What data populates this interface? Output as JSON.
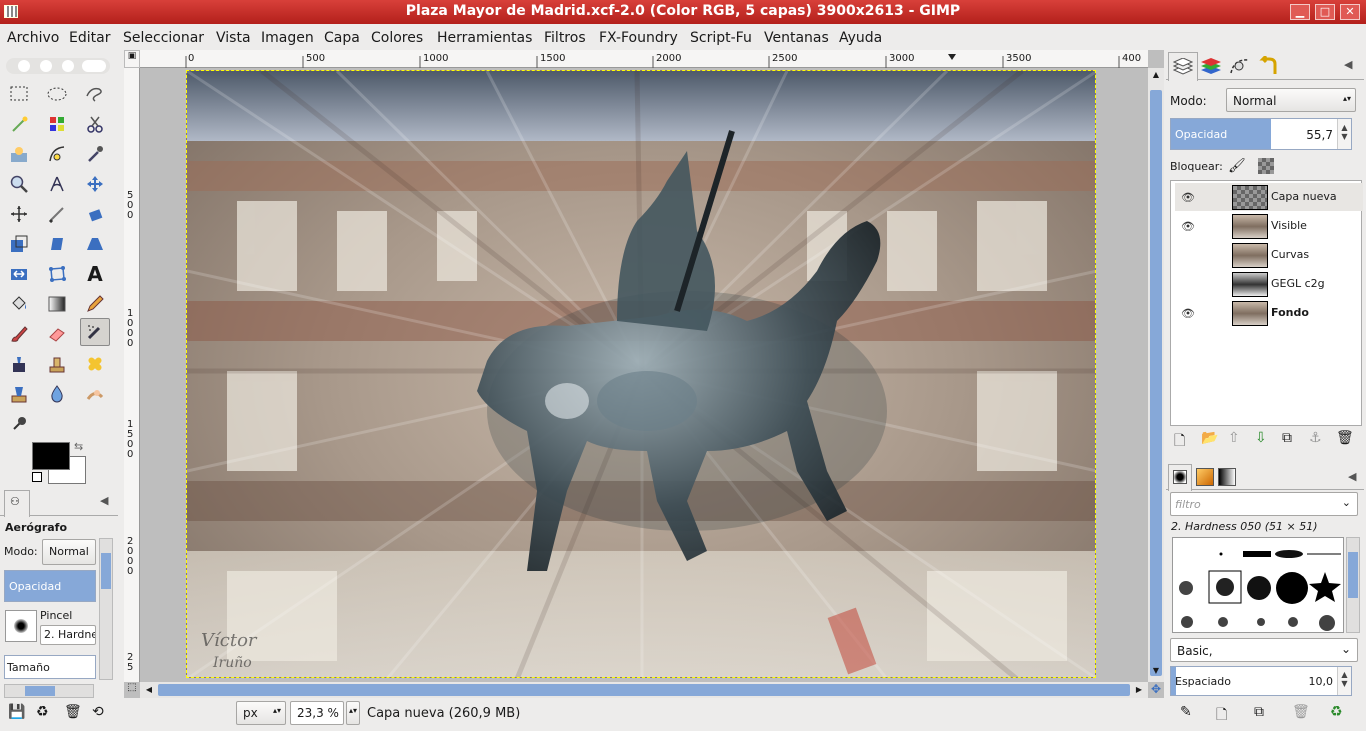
{
  "window": {
    "title": "Plaza Mayor de Madrid.xcf-2.0 (Color RGB, 5 capas) 3900x2613 - GIMP"
  },
  "menu": [
    "Archivo",
    "Editar",
    "Seleccionar",
    "Vista",
    "Imagen",
    "Capa",
    "Colores",
    "Herramientas",
    "Filtros",
    "FX-Foundry",
    "Script-Fu",
    "Ventanas",
    "Ayuda"
  ],
  "tool_options": {
    "tool_name": "Aerógrafo",
    "mode_label": "Modo:",
    "mode_value": "Normal",
    "opacity_label": "Opacidad",
    "brush_label": "Pincel",
    "brush_value": "2. Hardne",
    "size_label": "Tamaño"
  },
  "ruler": {
    "h_ticks": [
      "0",
      "500",
      "1000",
      "1500",
      "2000",
      "2500",
      "3000",
      "3500",
      "400"
    ],
    "v_ticks": [
      "5\n0\n0",
      "1\n0\n0\n0",
      "1\n5\n0\n0",
      "2\n0\n0\n0",
      "2\n5"
    ]
  },
  "status": {
    "unit": "px",
    "zoom": "23,3 %",
    "info": "Capa nueva (260,9 MB)"
  },
  "layers_panel": {
    "mode_label": "Modo:",
    "mode_value": "Normal",
    "opacity_label": "Opacidad",
    "opacity_value": "55,7",
    "opacity_fraction": 0.557,
    "lock_label": "Bloquear:",
    "layers": [
      {
        "name": "Capa nueva",
        "visible": true,
        "bold": false
      },
      {
        "name": "Visible",
        "visible": true,
        "bold": false
      },
      {
        "name": "Curvas",
        "visible": false,
        "bold": false
      },
      {
        "name": "GEGL c2g",
        "visible": false,
        "bold": false
      },
      {
        "name": "Fondo",
        "visible": true,
        "bold": true
      }
    ]
  },
  "brushes_panel": {
    "filter_placeholder": "filtro",
    "brush_title": "2. Hardness 050 (51 × 51)",
    "tag_value": "Basic,",
    "spacing_label": "Espaciado",
    "spacing_value": "10,0"
  },
  "colors": {
    "foreground": "#000000",
    "background": "#ffffff",
    "selection_accent": "#86a8d8"
  }
}
